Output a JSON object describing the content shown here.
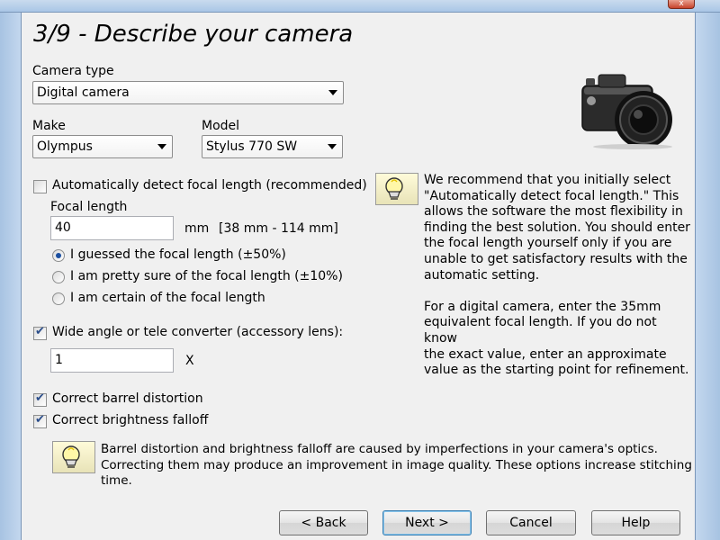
{
  "window": {
    "close_glyph": "x"
  },
  "title": "3/9 - Describe your camera",
  "camera_type": {
    "label": "Camera type",
    "value": "Digital camera"
  },
  "make": {
    "label": "Make",
    "value": "Olympus"
  },
  "model": {
    "label": "Model",
    "value": "Stylus 770 SW"
  },
  "auto_detect": {
    "label": "Automatically detect focal length (recommended)",
    "checked": false
  },
  "focal_length": {
    "label": "Focal length",
    "value": "40",
    "unit": "mm",
    "range": "[38 mm - 114 mm]"
  },
  "certainty": {
    "options": [
      {
        "label": "I guessed the focal length (±50%)",
        "selected": true
      },
      {
        "label": "I am pretty sure of the focal length (±10%)",
        "selected": false
      },
      {
        "label": "I am certain of the focal length",
        "selected": false
      }
    ]
  },
  "converter": {
    "label": "Wide angle or tele converter (accessory lens):",
    "checked": true,
    "value": "1",
    "unit": "X"
  },
  "barrel": {
    "label": "Correct barrel distortion",
    "checked": true
  },
  "brightness": {
    "label": "Correct brightness falloff",
    "checked": true
  },
  "hint_focal": {
    "lines": [
      "We recommend that you initially select",
      "\"Automatically detect focal length.\"  This",
      "allows the software the most flexibility in",
      "finding the best solution.  You should enter",
      "the focal length yourself only if you are",
      "unable to get satisfactory results with the",
      "automatic setting."
    ],
    "lines2": [
      "For a digital camera, enter the 35mm",
      "equivalent focal length.  If you do not know",
      "the exact value, enter an approximate",
      "value as the starting point for refinement."
    ]
  },
  "hint_optics": {
    "lines": [
      "Barrel distortion and brightness falloff are caused by imperfections in your camera's optics.",
      "Correcting them may produce an improvement in image quality.  These options increase stitching",
      "time."
    ]
  },
  "buttons": {
    "back": "< Back",
    "next": "Next >",
    "cancel": "Cancel",
    "help": "Help"
  },
  "icons": {
    "camera": "camera-icon",
    "hint": "lightbulb-icon"
  }
}
